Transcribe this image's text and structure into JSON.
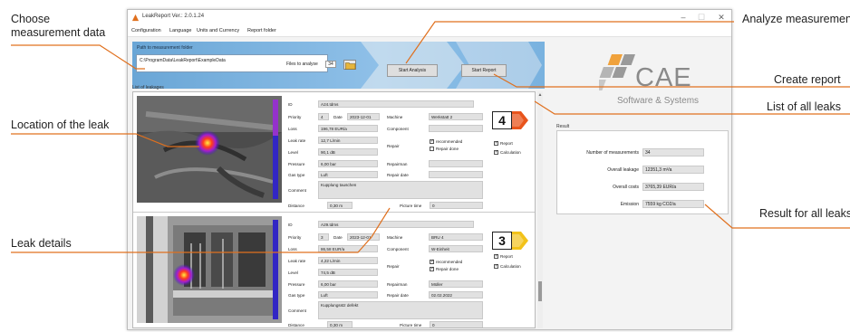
{
  "callouts": {
    "choose": [
      "Choose",
      "measurement data"
    ],
    "analyze": "Analyze measurements",
    "create": "Create report",
    "list": "List of all leaks",
    "location": "Location of the leak",
    "result": "Result for all leaks",
    "details": "Leak details"
  },
  "window": {
    "title": "LeakReport Ver.: 2.0.1.24",
    "controls": {
      "minimize": "–",
      "maximize": "☐",
      "close": "✕"
    },
    "menu": [
      "Configuration",
      "Language",
      "Units and Currency",
      "Report folder"
    ]
  },
  "toolbar": {
    "path_label": "Path to measurement folder",
    "path_value": "C:\\ProgramData\\LeakReport\\ExampleData",
    "files_label": "Files to analyse",
    "files_value": "34",
    "start_analysis": "Start Analysis",
    "start_report": "Start Report"
  },
  "logo": {
    "name": "CAE",
    "tagline": "Software & Systems"
  },
  "list_label": "List of leakages",
  "leaks": [
    {
      "id": "A24.tdms",
      "priority": "4",
      "date": "2023-12-01",
      "machine": "Werkstatt 2",
      "component": "",
      "loss": "196,78 EUR/a",
      "leak_rate": "12,7 L/min",
      "level": "90,1 dB",
      "pressure": "6,00 bar",
      "gas_type": "Luft",
      "repair_recommended": true,
      "repair_done": false,
      "repairman": "",
      "repair_date": "",
      "comment": "Kupplung tauschen",
      "distance": "0,30 m",
      "picture_time": "0",
      "report": true,
      "calculation": true,
      "badge_color": "#e8541c"
    },
    {
      "id": "A29.tdms",
      "priority": "3",
      "date": "2023-12-01",
      "machine": "BRU 4",
      "component": "W-Einheit",
      "loss": "86,58 EUR/a",
      "leak_rate": "4,22 L/min",
      "level": "74,5 dB",
      "pressure": "6,00 bar",
      "gas_type": "Luft",
      "repair_recommended": true,
      "repair_done": true,
      "repairman": "Müller",
      "repair_date": "02.02.2022",
      "comment": "Kupplungsstz defekt",
      "distance": "0,30 m",
      "picture_time": "0",
      "report": true,
      "calculation": true,
      "badge_color": "#f2c21a"
    }
  ],
  "field_labels": {
    "id": "ID",
    "priority": "Priority",
    "date": "Date",
    "machine": "Machine",
    "component": "Component",
    "loss": "Loss",
    "leak_rate": "Leak rate",
    "level": "Level",
    "pressure": "Pressure",
    "gas_type": "Gas type",
    "repair": "Repair",
    "recommended": "recommended",
    "repair_done": "Repair done",
    "repairman": "Repairman",
    "repair_date": "Repair date",
    "comment": "Comment",
    "distance": "Distance",
    "picture_time": "Picture time",
    "report": "Report",
    "calculation": "Calculation"
  },
  "result": {
    "label": "Result",
    "number_label": "Number of measurements",
    "number_value": "34",
    "leakage_label": "Overall leakage",
    "leakage_value": "12351,3 m³/a",
    "costs_label": "Overall costs",
    "costs_value": "3765,39 EUR/a",
    "emission_label": "Emission",
    "emission_value": "7559 kg CO2/a"
  },
  "colors": {
    "accent": "#e0701e",
    "banner": "#7fb5e0"
  }
}
